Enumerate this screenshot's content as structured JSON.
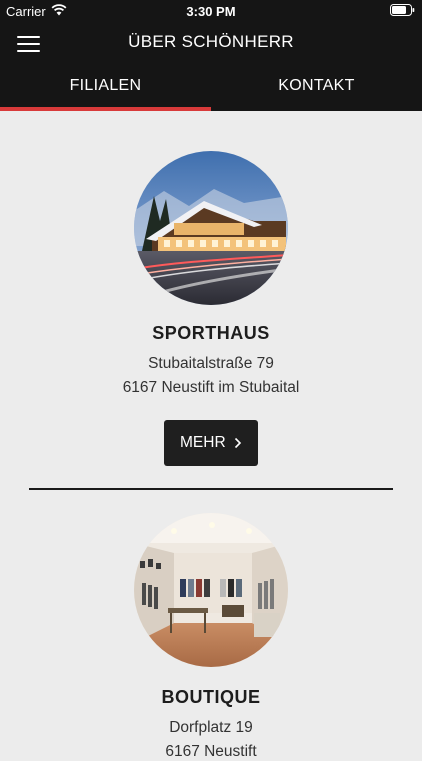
{
  "status_bar": {
    "carrier": "Carrier",
    "time": "3:30 PM"
  },
  "header": {
    "title": "ÜBER SCHÖNHERR",
    "menu_icon": "hamburger-menu-icon",
    "background": "#151515"
  },
  "tabs": [
    {
      "label": "FILIALEN",
      "active": true
    },
    {
      "label": "KONTAKT",
      "active": false
    }
  ],
  "accent_color": "#d83a3a",
  "branches": [
    {
      "name": "SPORTHAUS",
      "address_line1": "Stubaitalstraße 79",
      "address_line2": "6167 Neustift im Stubaital",
      "button_label": "MEHR",
      "button_icon": "chevron-right-icon"
    },
    {
      "name": "BOUTIQUE",
      "address_line1": "Dorfplatz 19",
      "address_line2": "6167 Neustift"
    }
  ]
}
